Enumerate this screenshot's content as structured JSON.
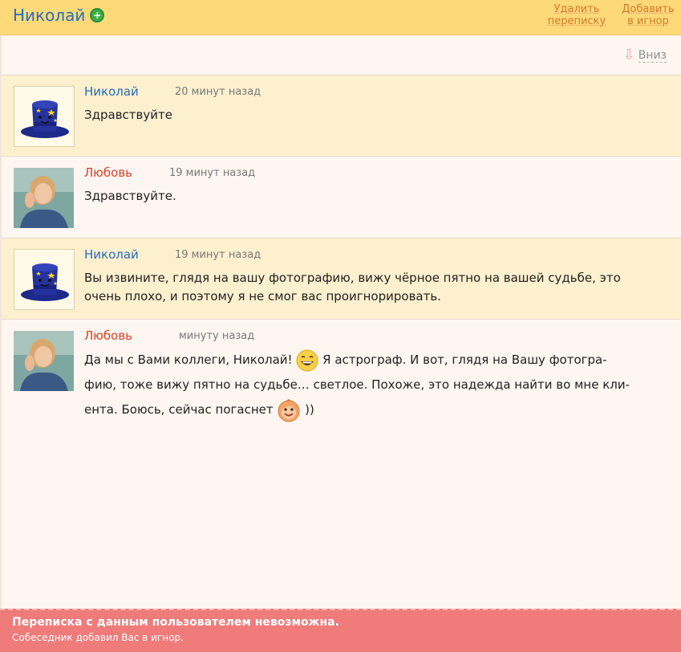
{
  "header": {
    "contact_name": "Николай",
    "delete_label_1": "Удалить",
    "delete_label_2": "переписку",
    "ignore_label_1": "Добавить",
    "ignore_label_2": "в игнор"
  },
  "down_link": "Вниз",
  "messages": [
    {
      "author": "Николай",
      "time": "20 минут назад",
      "text": "Здравствуйте"
    },
    {
      "author": "Любовь",
      "time": "19 минут назад",
      "text": "Здравствуйте."
    },
    {
      "author": "Николай",
      "time": "19 минут назад",
      "text_1": "Вы извините, глядя на вашу фотографию, вижу чёрное пятно на вашей судьбе, это",
      "text_2": "очень плохо, и поэтому я не смог вас проигнорировать."
    },
    {
      "author": "Любовь",
      "time": "минуту назад",
      "text_1a": "Да мы с Вами коллеги, Николай!",
      "text_1b": "Я астрограф. И вот, глядя на Вашу фотогра-",
      "text_2": "фию, тоже вижу пятно на судьбе… светлое. Похоже, это надежда найти во мне кли-",
      "text_3a": "ента. Боюсь, сейчас погаснет",
      "text_3b": "))"
    }
  ],
  "footer": {
    "title": "Переписка с данным пользователем невозможна.",
    "subtitle": "Собеседник добавил Вас в игнор."
  },
  "colors": {
    "header_bg": "#fdd97a",
    "name_nikolay": "#2a6cb5",
    "name_lubov": "#d9432a",
    "highlight_bg": "#fdf0cf",
    "footer_bg": "#ef7b7b"
  }
}
